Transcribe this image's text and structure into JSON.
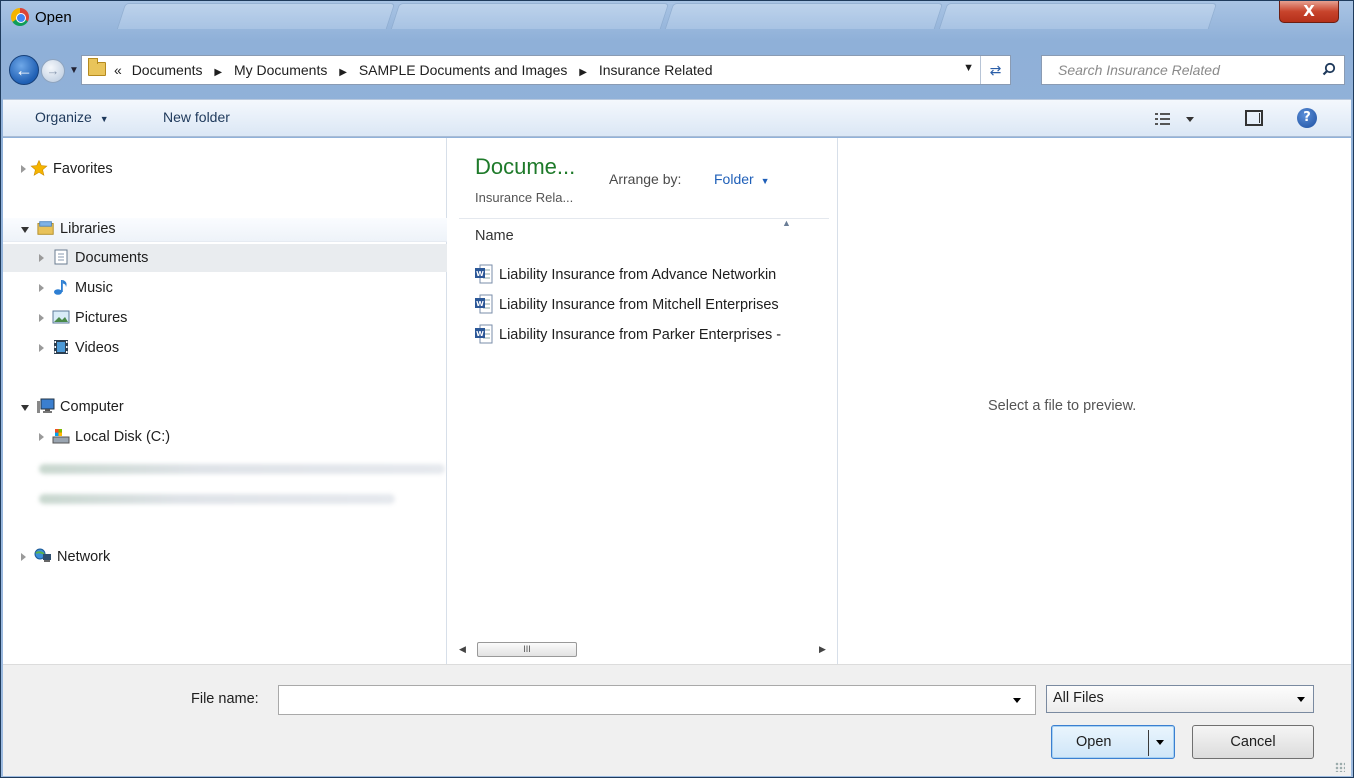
{
  "window": {
    "title": "Open",
    "close_label": "X"
  },
  "address": {
    "crumbs": [
      "«",
      "Documents",
      "My Documents",
      "SAMPLE Documents and Images",
      "Insurance Related"
    ],
    "search_placeholder": "Search Insurance Related"
  },
  "toolbar": {
    "organize_label": "Organize",
    "new_folder_label": "New folder",
    "help_label": "?"
  },
  "nav": {
    "favorites": "Favorites",
    "libraries": "Libraries",
    "documents": "Documents",
    "music": "Music",
    "pictures": "Pictures",
    "videos": "Videos",
    "computer": "Computer",
    "local_disk": "Local Disk (C:)",
    "network": "Network"
  },
  "file_pane": {
    "library_title": "Docume...",
    "library_subtitle": "Insurance Rela...",
    "arrange_label": "Arrange by:",
    "arrange_value": "Folder",
    "column_name": "Name",
    "files": [
      "Liability Insurance from Advance Networkin",
      "Liability Insurance from Mitchell Enterprises",
      "Liability Insurance from Parker Enterprises -"
    ],
    "scroll_thumb": "III"
  },
  "preview": {
    "message": "Select a file to preview."
  },
  "bottom": {
    "file_name_label": "File name:",
    "file_name_value": "",
    "filter_value": "All Files",
    "open_label": "Open",
    "cancel_label": "Cancel"
  },
  "colors": {
    "library_title": "#1e7a2a",
    "link_blue": "#1f5fb8",
    "close_red": "#c8442c"
  }
}
